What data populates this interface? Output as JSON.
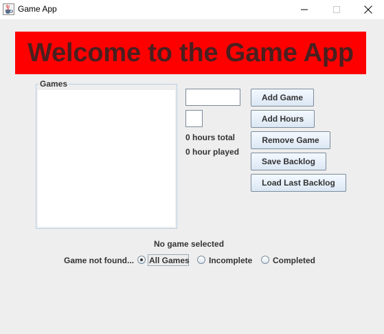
{
  "window": {
    "title": "Game App",
    "icons": {
      "app": "java-cup-icon",
      "minimize": "minimize-icon",
      "maximize": "maximize-icon",
      "close": "close-icon"
    }
  },
  "banner": {
    "text": "Welcome to the Game App",
    "background": "#ff0000",
    "text_color": "#4a1f1f"
  },
  "games_panel": {
    "title": "Games",
    "items": []
  },
  "inputs": {
    "game_name_value": "",
    "hours_value": ""
  },
  "stats": {
    "hours_total": "0 hours total",
    "hours_played": "0 hour played"
  },
  "buttons": {
    "add_game": "Add Game",
    "add_hours": "Add Hours",
    "remove_game": "Remove Game",
    "save_backlog": "Save Backlog",
    "load_last_backlog": "Load Last Backlog"
  },
  "status": {
    "selection": "No game selected",
    "search": "Game not found..."
  },
  "filters": {
    "selected": "All Games",
    "options": [
      "All Games",
      "Incomplete",
      "Completed"
    ]
  }
}
